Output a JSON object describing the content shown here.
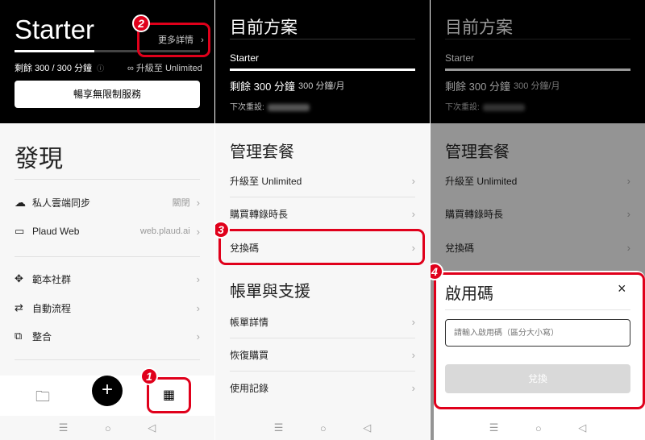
{
  "panel1": {
    "plan_name": "Starter",
    "more_details": "更多詳情",
    "remaining": "剩餘 300 / 300 分鐘",
    "upgrade": "∞ 升級至 Unlimited",
    "cta": "暢享無限制服務",
    "progress": 0.43,
    "discover_title": "發現",
    "items": [
      {
        "label": "私人雲端同步",
        "value": "關閉"
      },
      {
        "label": "Plaud Web",
        "value": "web.plaud.ai"
      },
      {
        "label": "範本社群",
        "value": ""
      },
      {
        "label": "自動流程",
        "value": ""
      },
      {
        "label": "整合",
        "value": ""
      }
    ]
  },
  "panel2": {
    "title": "目前方案",
    "plan": "Starter",
    "minutes": "剩餘 300 分鐘",
    "per_month": "300 分鐘/月",
    "next_reset": "下次重設:",
    "manage_title": "管理套餐",
    "manage_items": [
      "升級至 Unlimited",
      "購買轉錄時長",
      "兌換碼"
    ],
    "billing_title": "帳單與支援",
    "billing_items": [
      "帳單詳情",
      "恢復購買",
      "使用記錄"
    ]
  },
  "panel3": {
    "dialog_title": "啟用碼",
    "close": "×",
    "placeholder": "請輸入啟用碼（區分大小寫）",
    "submit": "兌換"
  },
  "steps": [
    "1",
    "2",
    "3",
    "4"
  ],
  "nav": {
    "menu": "☰",
    "home": "○",
    "back": "◁"
  },
  "colors": {
    "accent": "#e0001b",
    "dark": "#000000"
  }
}
